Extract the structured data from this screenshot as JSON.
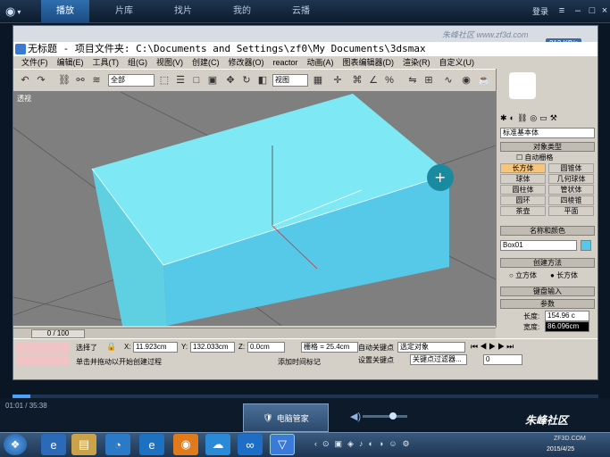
{
  "player": {
    "tabs": [
      "播放",
      "片库",
      "找片",
      "我的",
      "云播"
    ],
    "active_tab": "播放",
    "login": "登录",
    "time": "01:01 / 35:38",
    "progress": 0.03,
    "notification": "电脑管家"
  },
  "max": {
    "title": "无标题    - 项目文件夹: C:\\Documents and Settings\\zf0\\My Documents\\3dsmax",
    "watermark": "朱峰社区 www.zf3d.com",
    "speed": "213 KB/s",
    "menu": [
      "文件(F)",
      "编辑(E)",
      "工具(T)",
      "组(G)",
      "视图(V)",
      "创建(C)",
      "修改器(O)",
      "reactor",
      "动画(A)",
      "图表编辑器(D)",
      "渲染(R)",
      "自定义(U)"
    ],
    "toolbar": {
      "select_filter": "全部",
      "ref_coord": "视图"
    },
    "viewport_label": "透视",
    "panel": {
      "category": "标准基本体",
      "object_type": "对象类型",
      "autogrid": "自动栅格",
      "buttons": [
        "长方体",
        "圆锥体",
        "球体",
        "几何球体",
        "圆柱体",
        "管状体",
        "圆环",
        "四棱锥",
        "茶壶",
        "平面"
      ],
      "name_color": "名称和颜色",
      "object_name": "Box01",
      "object_color": "#56c8e8",
      "create_method": "创建方法",
      "method_cube": "立方体",
      "method_box": "长方体",
      "keyboard_entry": "键盘输入",
      "params": "参数",
      "length_label": "长度:",
      "length_value": "154.96 c",
      "width_label": "宽度:",
      "width_value": "86.096cm"
    },
    "timeline": "0 / 100",
    "status": {
      "selected": "选择了",
      "x_label": "X:",
      "x": "11.923cm",
      "y_label": "Y:",
      "y": "132.033cm",
      "z_label": "Z:",
      "z": "0.0cm",
      "grid": "栅格 = 25.4cm",
      "auto_key": "自动关键点",
      "filter": "选定对象",
      "set_key": "设置关键点",
      "key_filters": "关键点过滤器...",
      "prompt": "单击并拖动以开始创建过程",
      "add_time_tag": "添加时间标记",
      "frame": "0"
    }
  },
  "taskbar": {
    "clock": "2015/4/25",
    "brand": "朱峰社区",
    "brand_url": "ZF3D.COM"
  }
}
